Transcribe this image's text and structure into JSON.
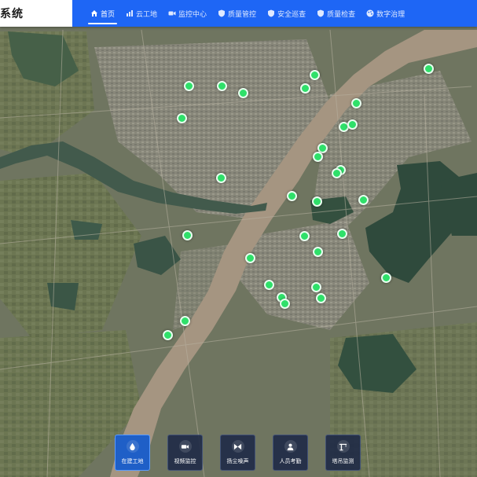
{
  "header": {
    "title": "系统",
    "nav": [
      {
        "label": "首页",
        "icon": "home-icon",
        "active": true
      },
      {
        "label": "云工地",
        "icon": "bar-chart-icon",
        "active": false
      },
      {
        "label": "监控中心",
        "icon": "video-camera-icon",
        "active": false
      },
      {
        "label": "质量管控",
        "icon": "shield-icon",
        "active": false
      },
      {
        "label": "安全巡查",
        "icon": "shield-icon",
        "active": false
      },
      {
        "label": "质量检查",
        "icon": "shield-icon",
        "active": false
      },
      {
        "label": "数字治理",
        "icon": "palette-icon",
        "active": false
      }
    ]
  },
  "map": {
    "marker_color": "#2fe06a",
    "marker_count": 37
  },
  "dock": [
    {
      "label": "在建工地",
      "icon": "water-drop-icon",
      "active": true
    },
    {
      "label": "视频监控",
      "icon": "camera-icon",
      "active": false
    },
    {
      "label": "扬尘噪声",
      "icon": "wind-icon",
      "active": false
    },
    {
      "label": "人员考勤",
      "icon": "person-icon",
      "active": false
    },
    {
      "label": "塔吊监测",
      "icon": "crane-icon",
      "active": false
    }
  ],
  "colors": {
    "header_bg": "#1e66f5",
    "header_brand_bg": "#ffffff",
    "dock_active": "#1f5fc7"
  }
}
